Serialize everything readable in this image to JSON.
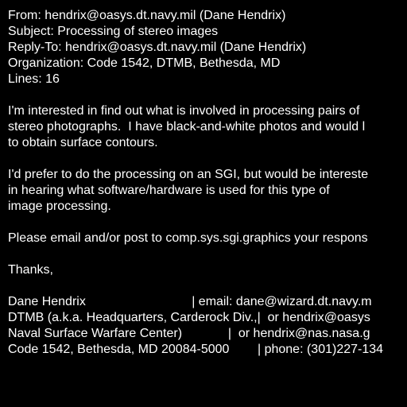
{
  "colors": {
    "background": "#000000",
    "text": "#ffffff"
  },
  "message": {
    "headers": [
      "From: hendrix@oasys.dt.navy.mil (Dane Hendrix)",
      "Subject: Processing of stereo images",
      "Reply-To: hendrix@oasys.dt.navy.mil (Dane Hendrix)",
      "Organization: Code 1542, DTMB, Bethesda, MD",
      "Lines: 16"
    ],
    "body": [
      "I'm interested in find out what is involved in processing pairs of",
      "stereo photographs.  I have black-and-white photos and would l",
      "to obtain surface contours.",
      "I'd prefer to do the processing on an SGI, but would be intereste",
      "in hearing what software/hardware is used for this type of",
      "image processing.",
      "Please email and/or post to comp.sys.sgi.graphics your respons",
      "Thanks,"
    ],
    "signature": [
      "Dane Hendrix                              | email: dane@wizard.dt.navy.m",
      "DTMB (a.k.a. Headquarters, Carderock Div.,|  or hendrix@oasys",
      "Naval Surface Warfare Center)             |  or hendrix@nas.nasa.g",
      "Code 1542, Bethesda, MD 20084-5000        | phone: (301)227-134"
    ]
  }
}
